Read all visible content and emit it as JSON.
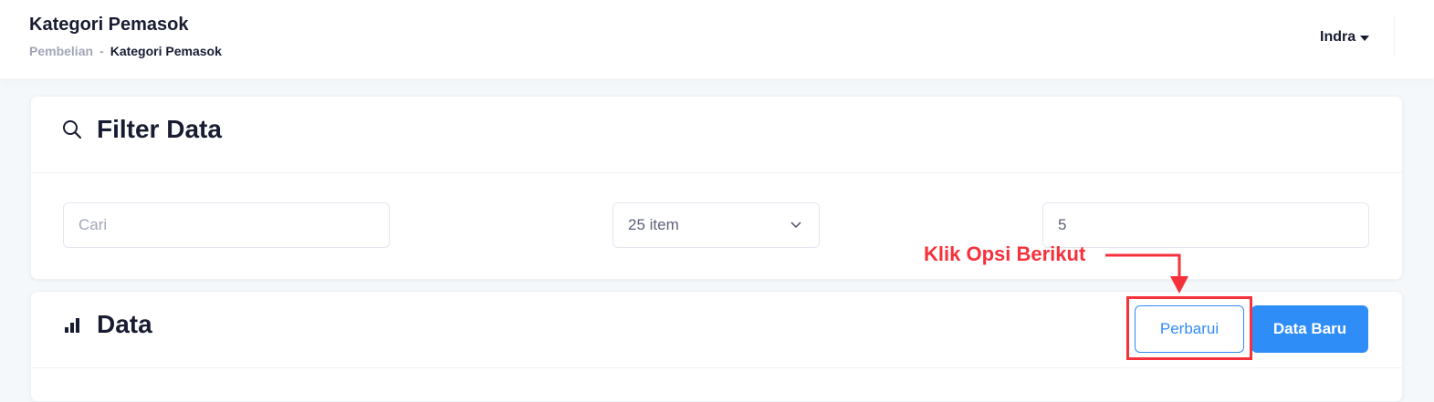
{
  "header": {
    "title": "Kategori Pemasok",
    "breadcrumb": {
      "parent": "Pembelian",
      "separator": "-",
      "current": "Kategori Pemasok"
    },
    "user": "Indra"
  },
  "filter": {
    "title": "Filter Data",
    "icon": "search-icon",
    "search_placeholder": "Cari",
    "per_page_selected": "25 item",
    "page_value": "5"
  },
  "annotation": {
    "text": "Klik Opsi Berikut",
    "color": "#f5313b"
  },
  "data": {
    "title": "Data",
    "icon": "bar-chart-icon",
    "refresh_label": "Perbarui",
    "new_label": "Data Baru"
  },
  "colors": {
    "primary": "#2f8df7",
    "heading": "#181c32",
    "muted": "#a1a5b7"
  }
}
